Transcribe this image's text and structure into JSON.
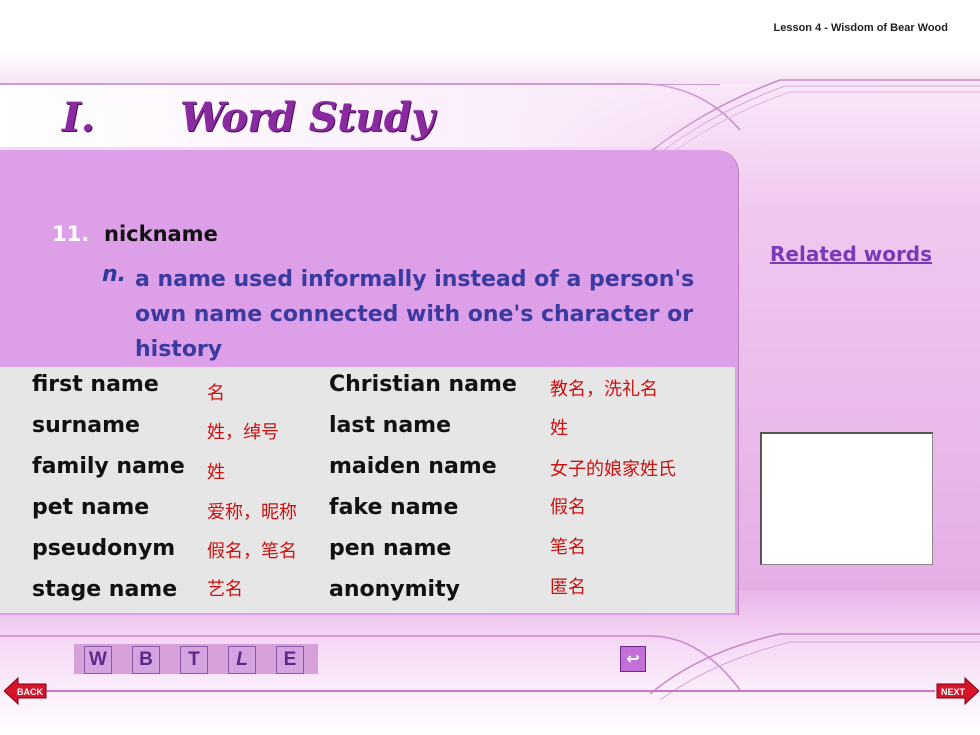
{
  "header": {
    "lesson": "Lesson 4 - Wisdom of Bear Wood"
  },
  "title": {
    "number": "I.",
    "text": "Word Study"
  },
  "entry": {
    "number": "11.",
    "word": "nickname",
    "pos": "n.",
    "definition": "a name used informally instead of a person's own name connected with one's character or history"
  },
  "related": {
    "label": "Related words"
  },
  "table": {
    "rows": [
      {
        "en1": "first name",
        "zh1": "名",
        "en2": "Christian name",
        "zh2": "教名，洗礼名"
      },
      {
        "en1": "surname",
        "zh1": "姓，绰号",
        "en2": "last name",
        "zh2": "姓"
      },
      {
        "en1": "family name",
        "zh1": "姓",
        "en2": "maiden name",
        "zh2": "女子的娘家姓氏"
      },
      {
        "en1": "pet name",
        "zh1": "爱称，昵称",
        "en2": "fake name",
        "zh2": "假名"
      },
      {
        "en1": "pseudonym",
        "zh1": "假名，笔名",
        "en2": "pen name",
        "zh2": "笔名"
      },
      {
        "en1": "stage name",
        "zh1": "艺名",
        "en2": "anonymity",
        "zh2": "匿名"
      }
    ]
  },
  "nav": {
    "buttons": [
      "W",
      "B",
      "T",
      "L",
      "E"
    ],
    "return_icon": "return-icon",
    "back_label": "BACK",
    "next_label": "NEXT"
  },
  "colors": {
    "accent": "#8a2aa0",
    "panel": "#dd9fe8",
    "chinese": "#cc1111"
  }
}
